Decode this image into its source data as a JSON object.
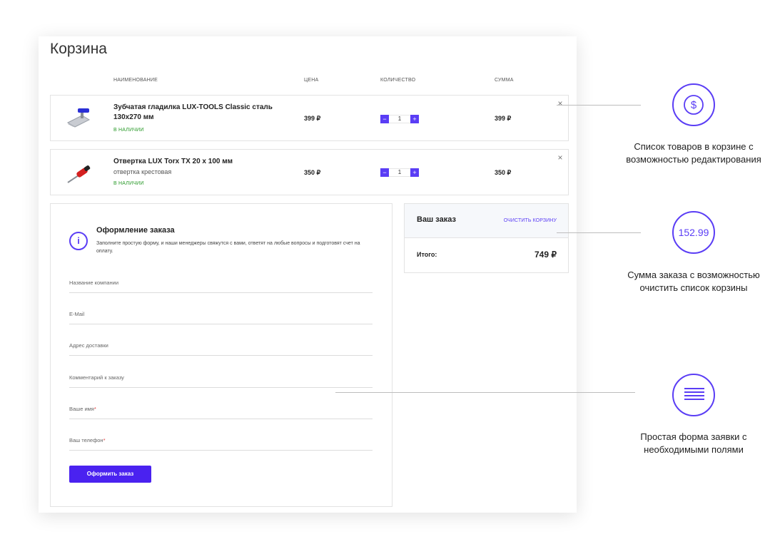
{
  "cart": {
    "title": "Корзина",
    "headers": {
      "name": "НАИМЕНОВАНИЕ",
      "price": "ЦЕНА",
      "quantity": "КОЛИЧЕСТВО",
      "sum": "СУММА"
    },
    "items": [
      {
        "name": "Зубчатая гладилка LUX-TOOLS Classic сталь 130х270 мм",
        "subtitle": "",
        "stock": "В НАЛИЧИИ",
        "price": "399 ₽",
        "quantity": "1",
        "sum": "399 ₽",
        "icon": "trowel-icon"
      },
      {
        "name": "Отвертка LUX Torx TX 20 x 100 мм",
        "subtitle": "отвертка крестовая",
        "stock": "В НАЛИЧИИ",
        "price": "350 ₽",
        "quantity": "1",
        "sum": "350 ₽",
        "icon": "screwdriver-icon"
      }
    ]
  },
  "checkout": {
    "title": "Оформление заказа",
    "description": "Заполните простую форму, и наши менеджеры свяжутся с вами, ответят на любые вопросы и подготовят счет на оплату.",
    "fields": [
      {
        "label": "Название компании",
        "required": false
      },
      {
        "label": "E-Mail",
        "required": false
      },
      {
        "label": "Адрес доставки",
        "required": false
      },
      {
        "label": "Комментарий к заказу",
        "required": false
      },
      {
        "label": "Ваше имя",
        "required": true
      },
      {
        "label": "Ваш телефон",
        "required": true
      }
    ],
    "required_mark": "*",
    "submit_label": "Оформить заказ"
  },
  "order": {
    "title": "Ваш заказ",
    "clear_label": "ОЧИСТИТЬ КОРЗИНУ",
    "total_label": "Итого:",
    "total_value": "749 ₽"
  },
  "annotations": [
    {
      "icon": "dollar-icon",
      "badge_text": "",
      "caption": "Список товаров в корзине с возможностью редактирования"
    },
    {
      "icon": "",
      "badge_text": "152.99",
      "caption": "Сумма заказа с возможностью очистить список корзины"
    },
    {
      "icon": "list-icon",
      "badge_text": "",
      "caption": "Простая форма заявки с необходимыми полями"
    }
  ],
  "colors": {
    "accent": "#5a3df5",
    "button": "#4a22f0",
    "in_stock": "#2a9a2a",
    "required": "#e23c3c"
  }
}
